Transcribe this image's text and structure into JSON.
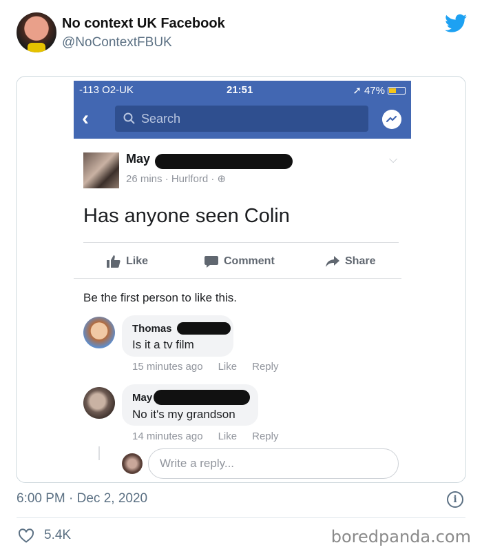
{
  "tweet": {
    "author_name": "No context UK Facebook",
    "author_handle": "@NoContextFBUK",
    "timestamp": "6:00 PM · Dec 2, 2020",
    "like_count": "5.4K",
    "watermark": "boredpanda.com"
  },
  "phone": {
    "carrier": "-113 O2-UK",
    "time": "21:51",
    "battery": "47%",
    "battery_level": 0.47
  },
  "facebook": {
    "search_placeholder": "Search",
    "post": {
      "author": "May",
      "meta": "26 mins · Hurlford · ",
      "text": "Has anyone seen Colin"
    },
    "actions": {
      "like": "Like",
      "comment": "Comment",
      "share": "Share"
    },
    "likes_summary": "Be the first person to like this.",
    "comments": [
      {
        "author": "Thomas",
        "text": "Is it a tv film",
        "time": "15 minutes ago",
        "like": "Like",
        "reply": "Reply"
      },
      {
        "author": "May",
        "text": "No it's my grandson",
        "time": "14 minutes ago",
        "like": "Like",
        "reply": "Reply"
      }
    ],
    "reply_placeholder": "Write a reply..."
  },
  "colors": {
    "facebook_blue": "#4267b2",
    "twitter_blue": "#1da1f2",
    "muted_text": "#5b7083",
    "bubble_gray": "#f2f3f5"
  }
}
